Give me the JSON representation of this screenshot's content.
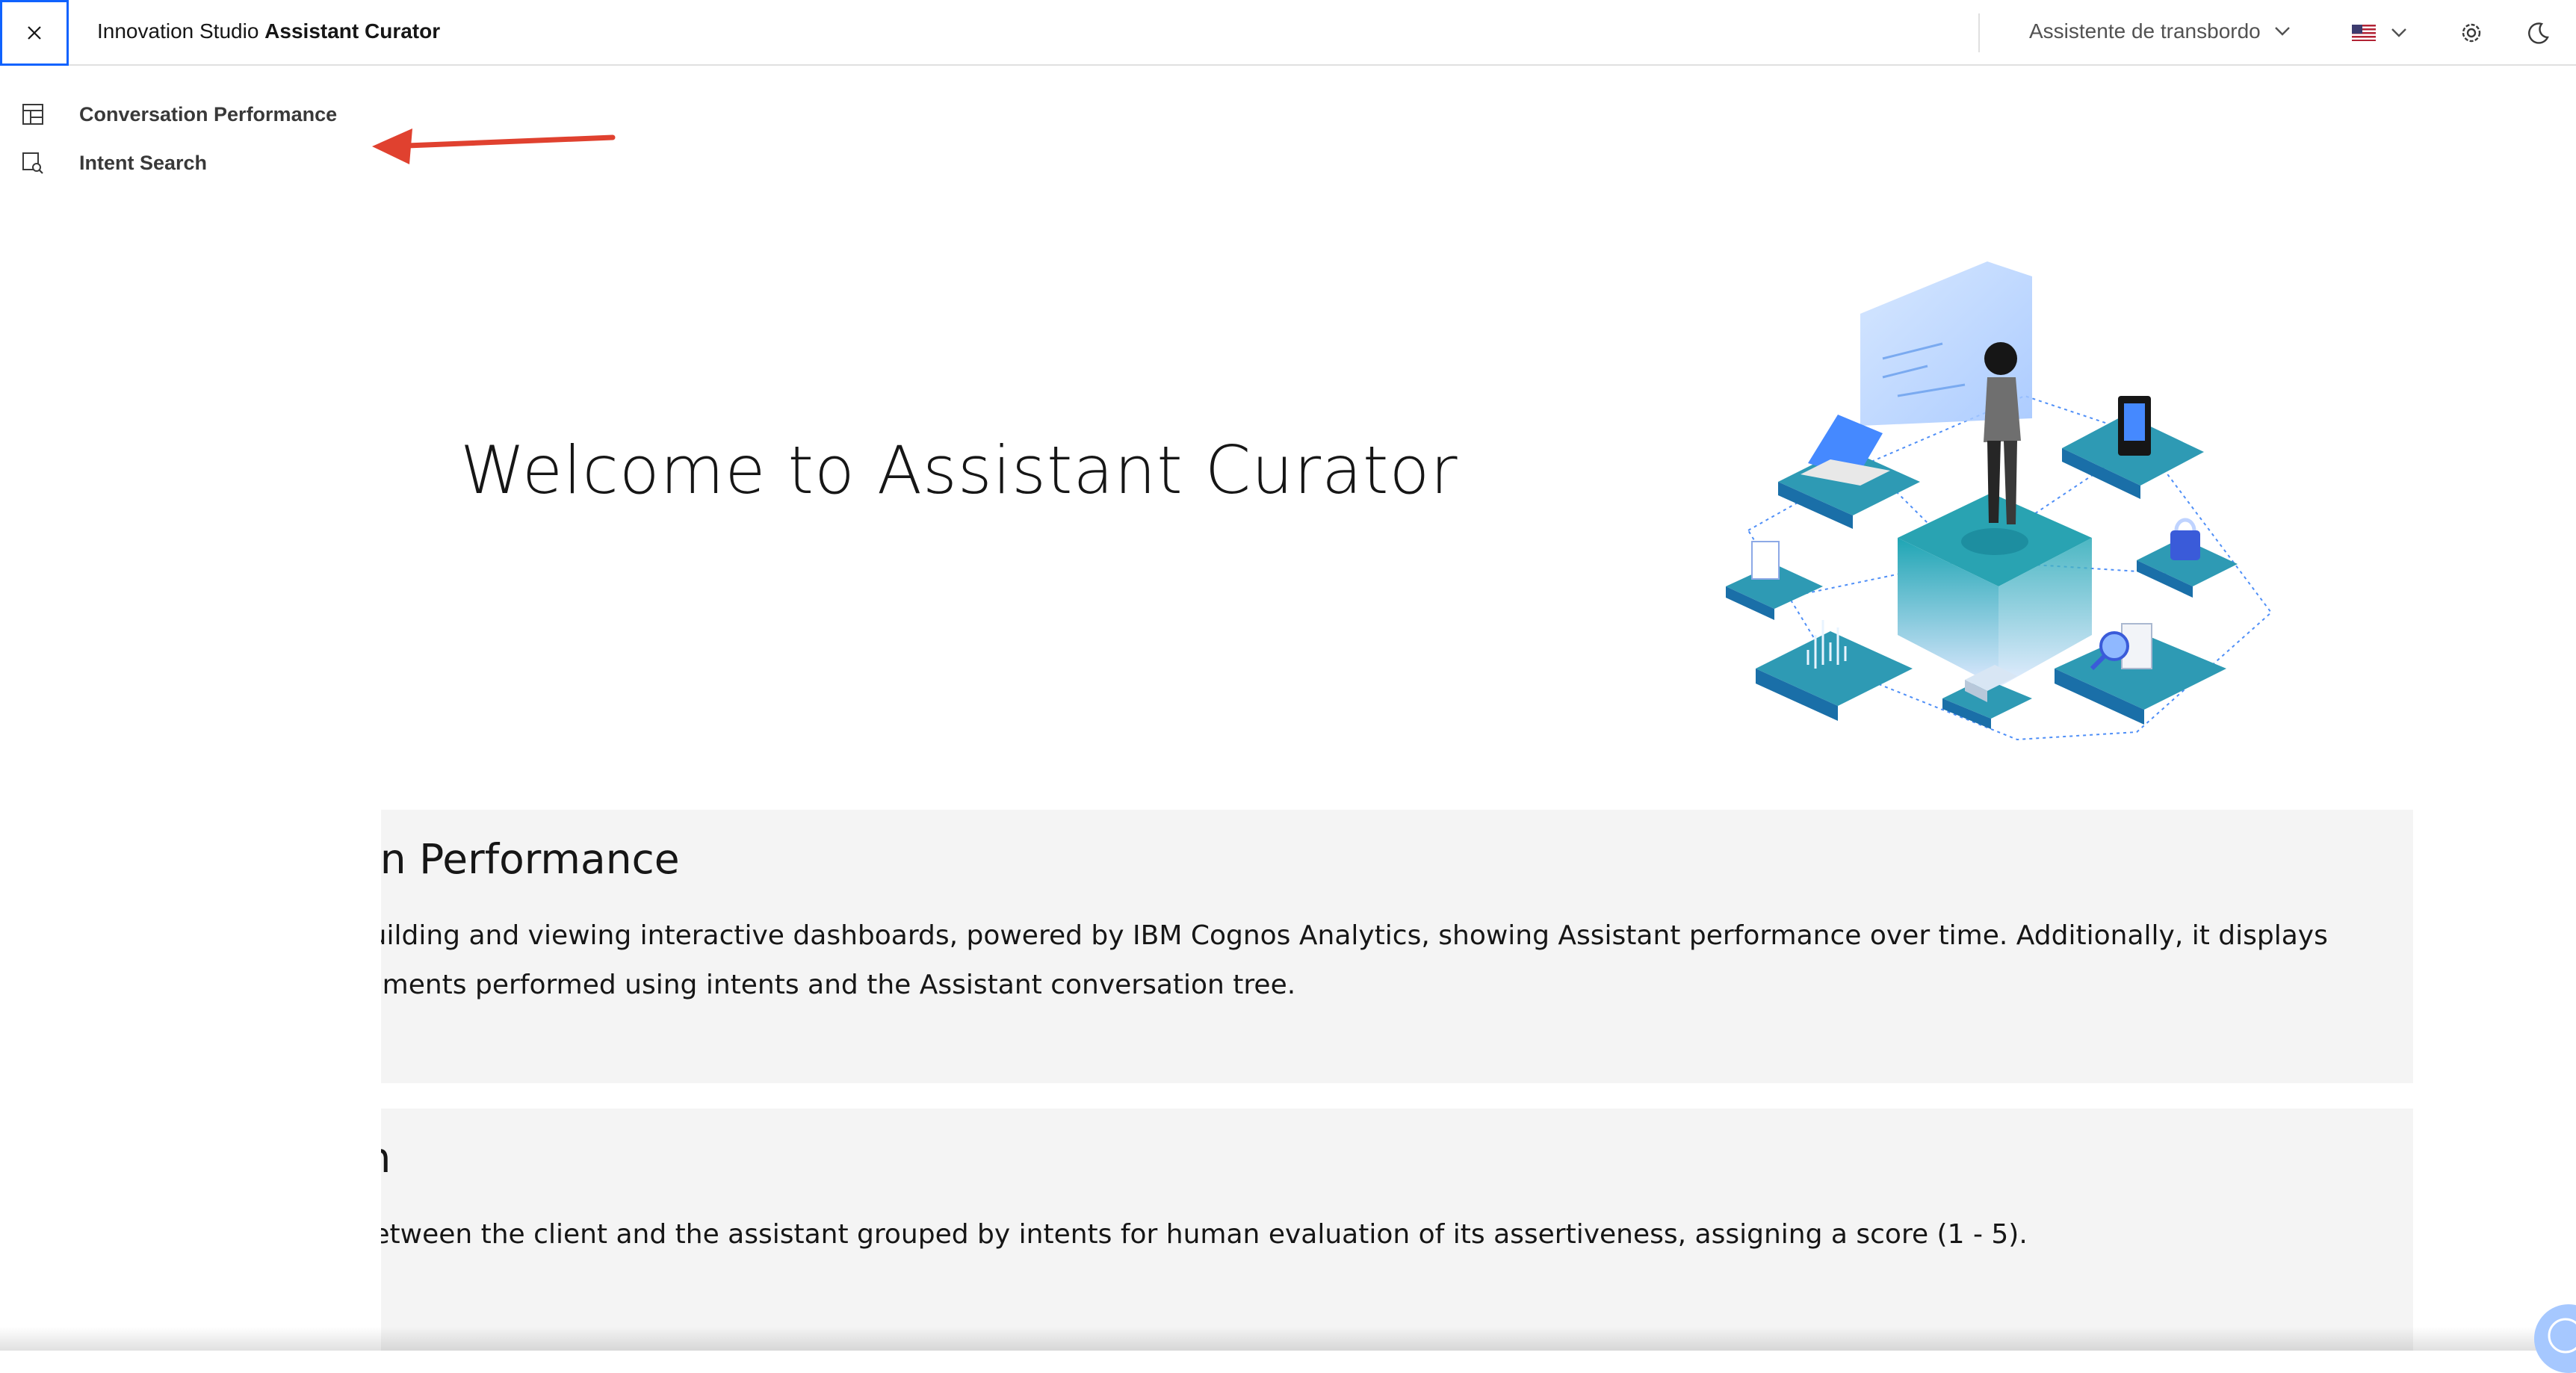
{
  "header": {
    "brand_prefix": "Innovation Studio",
    "brand_product": "Assistant Curator",
    "assistant_select": "Assistente de transbordo",
    "language_flag": "us-flag-icon",
    "icons": [
      "close-icon",
      "settings-gear-icon",
      "moon-icon",
      "chevron-down-icon"
    ]
  },
  "nav": {
    "items": [
      {
        "label": "Conversation Performance",
        "icon": "dashboard-icon"
      },
      {
        "label": "Intent Search",
        "icon": "search-document-icon"
      }
    ]
  },
  "hero": {
    "title": "Welcome to Assistant Curator"
  },
  "cards": [
    {
      "title": "Conversation Performance",
      "description": "An interface for building and viewing interactive dashboards, powered by IBM Cognos Analytics, showing Assistant performance over time. Additionally, it displays charts from experiments performed using intents and the Assistant conversation tree."
    },
    {
      "title": "Intent Search",
      "description": "The conversation between the client and the assistant grouped by intents for human evaluation of its assertiveness, assigning a score (1 - 5)."
    }
  ],
  "colors": {
    "accent": "#0f62fe",
    "arrow": "#e0412f",
    "card_bg": "#f4f4f4"
  }
}
